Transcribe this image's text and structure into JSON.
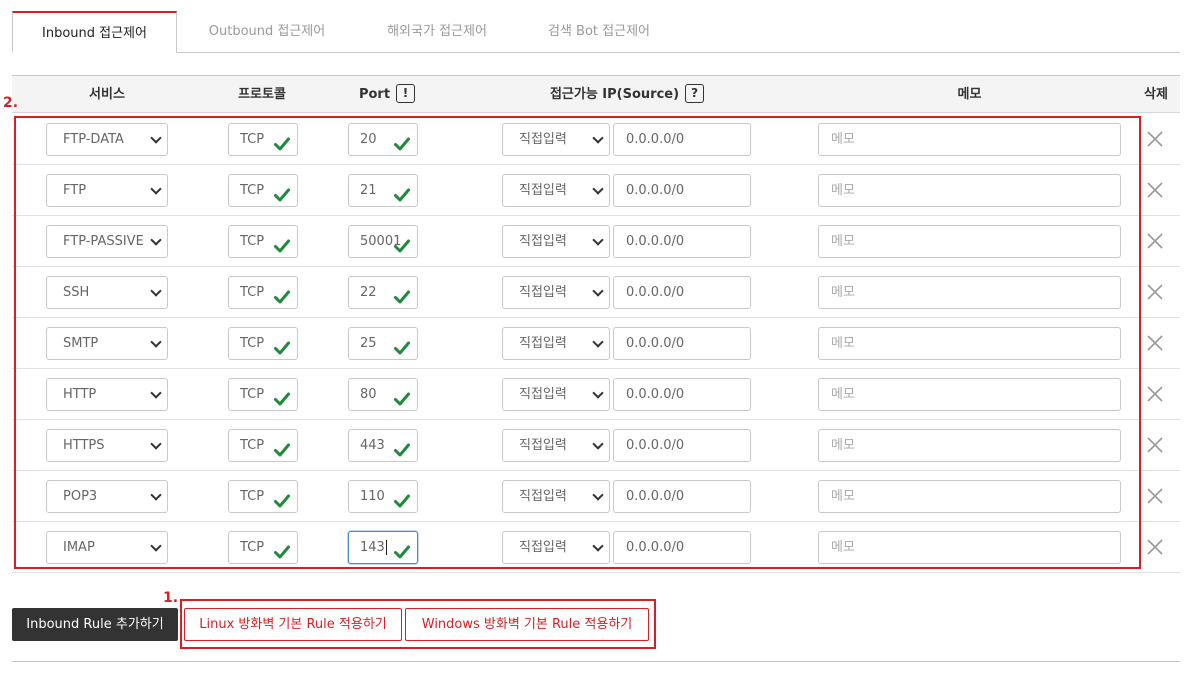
{
  "tabs": [
    {
      "label": "Inbound 접근제어",
      "active": true
    },
    {
      "label": "Outbound 접근제어",
      "active": false
    },
    {
      "label": "해외국가 접근제어",
      "active": false
    },
    {
      "label": "검색 Bot 접근제어",
      "active": false
    }
  ],
  "table": {
    "headers": {
      "service": "서비스",
      "protocol": "프로토콜",
      "port": "Port",
      "port_hint": "!",
      "source_ip": "접근가능 IP(Source)",
      "source_hint": "?",
      "memo": "메모",
      "delete": "삭제"
    },
    "rows": [
      {
        "service": "FTP-DATA",
        "protocol": "TCP",
        "port": "20",
        "ip_mode": "직접입력",
        "ip": "0.0.0.0/0",
        "memo_placeholder": "메모"
      },
      {
        "service": "FTP",
        "protocol": "TCP",
        "port": "21",
        "ip_mode": "직접입력",
        "ip": "0.0.0.0/0",
        "memo_placeholder": "메모"
      },
      {
        "service": "FTP-PASSIVE",
        "protocol": "TCP",
        "port": "50001",
        "ip_mode": "직접입력",
        "ip": "0.0.0.0/0",
        "memo_placeholder": "메모"
      },
      {
        "service": "SSH",
        "protocol": "TCP",
        "port": "22",
        "ip_mode": "직접입력",
        "ip": "0.0.0.0/0",
        "memo_placeholder": "메모"
      },
      {
        "service": "SMTP",
        "protocol": "TCP",
        "port": "25",
        "ip_mode": "직접입력",
        "ip": "0.0.0.0/0",
        "memo_placeholder": "메모"
      },
      {
        "service": "HTTP",
        "protocol": "TCP",
        "port": "80",
        "ip_mode": "직접입력",
        "ip": "0.0.0.0/0",
        "memo_placeholder": "메모"
      },
      {
        "service": "HTTPS",
        "protocol": "TCP",
        "port": "443",
        "ip_mode": "직접입력",
        "ip": "0.0.0.0/0",
        "memo_placeholder": "메모"
      },
      {
        "service": "POP3",
        "protocol": "TCP",
        "port": "110",
        "ip_mode": "직접입력",
        "ip": "0.0.0.0/0",
        "memo_placeholder": "메모"
      },
      {
        "service": "IMAP",
        "protocol": "TCP",
        "port": "143",
        "ip_mode": "직접입력",
        "ip": "0.0.0.0/0",
        "memo_placeholder": "메모"
      }
    ]
  },
  "annotations": {
    "rows_marker": "2.",
    "buttons_marker": "1."
  },
  "buttons": {
    "add_rule": "Inbound Rule 추가하기",
    "linux_rules": "Linux 방화벽 기본 Rule 적용하기",
    "windows_rules": "Windows 방화벽 기본 Rule 적용하기"
  },
  "colors": {
    "accent_red": "#d61f26",
    "check_green": "#1f8a3c",
    "dark_button": "#333333"
  }
}
